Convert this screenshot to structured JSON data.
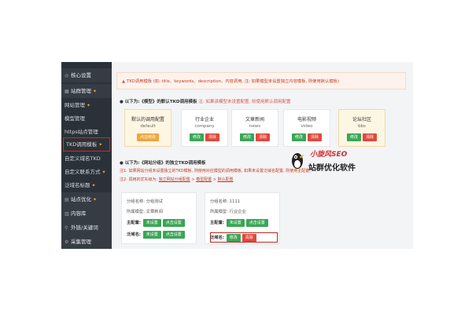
{
  "sidebar": {
    "items": [
      {
        "label": "核心设置",
        "type": "main"
      },
      {
        "label": "站群管理",
        "type": "main",
        "fire": true
      },
      {
        "label": "网站管理",
        "type": "sub",
        "fire": true
      },
      {
        "label": "模型管理",
        "type": "sub"
      },
      {
        "label": "https站点管理",
        "type": "sub"
      },
      {
        "label": "TKD调用模板",
        "type": "sub",
        "fire": true,
        "active": true
      },
      {
        "label": "自定义域名TKD",
        "type": "sub"
      },
      {
        "label": "自定义联系方式",
        "type": "sub",
        "fire": true
      },
      {
        "label": "泛域名标题",
        "type": "sub",
        "fire": true
      },
      {
        "label": "站点优化",
        "type": "main",
        "fire": true
      },
      {
        "label": "内容库",
        "type": "main"
      },
      {
        "label": "外链/关键词",
        "type": "main"
      },
      {
        "label": "采集管理",
        "type": "main"
      }
    ]
  },
  "notice": {
    "text": "TKD调用模板 (如: title、keywords、description、内容调用, 注: 如果模型未设置独立内容模板, 则使用默认模板)"
  },
  "model_section": {
    "title_prefix": "● 以下为:《模型》的默认TKD调用模板",
    "title_note": "注: 如果该模型未设置配置, 则使用默认调用配置",
    "cards": [
      {
        "name": "默认的调用配置",
        "code": "default",
        "selected": true,
        "buttons": [
          {
            "label": "点击修改",
            "color": "orange"
          }
        ]
      },
      {
        "name": "行业企业",
        "code": "company",
        "selected": false,
        "buttons": [
          {
            "label": "修改",
            "color": "green"
          },
          {
            "label": "清除",
            "color": "red"
          }
        ]
      },
      {
        "name": "文章新闻",
        "code": "news",
        "selected": false,
        "buttons": [
          {
            "label": "修改",
            "color": "green"
          },
          {
            "label": "清除",
            "color": "red"
          }
        ]
      },
      {
        "name": "电影视频",
        "code": "video",
        "selected": false,
        "buttons": [
          {
            "label": "修改",
            "color": "green"
          },
          {
            "label": "清除",
            "color": "red"
          }
        ]
      },
      {
        "name": "论坛社区",
        "code": "bbs",
        "selected": true,
        "buttons": [
          {
            "label": "修改",
            "color": "green"
          },
          {
            "label": "清除",
            "color": "red"
          }
        ]
      }
    ]
  },
  "group_section": {
    "title_prefix": "● 以下为:《网站分组》的独立TKD调用模板",
    "note1": "注1: 如果网站分组未设置独立的TKD模板, 则使用对应模型的调用模板, 如果未设置泛域名配置, 则使用主配置;",
    "note2_prefix": "注2: 调用的优先级为: ",
    "note2_links": [
      "独立网站分组配置",
      "模型配置",
      "默认配置"
    ],
    "panels": [
      {
        "group_name_label": "分组名称:",
        "group_name": "分组测试",
        "model_label": "所属模型:",
        "model": "文章新闻",
        "main_label": "主配置:",
        "main_buttons": [
          {
            "label": "未设置",
            "color": "green"
          },
          {
            "label": "点击设置",
            "color": "green"
          }
        ],
        "domain_label": "泛域名:",
        "domain_buttons": [
          {
            "label": "未设置",
            "color": "green"
          },
          {
            "label": "点击设置",
            "color": "green"
          }
        ],
        "highlight": false
      },
      {
        "group_name_label": "分组名称:",
        "group_name": "1111",
        "model_label": "所属模型:",
        "model": "行业企业",
        "main_label": "主配置:",
        "main_buttons": [
          {
            "label": "未设置",
            "color": "green"
          },
          {
            "label": "点击设置",
            "color": "green"
          }
        ],
        "domain_label": "泛域名:",
        "domain_buttons": [
          {
            "label": "修改",
            "color": "green"
          },
          {
            "label": "清除",
            "color": "red"
          }
        ],
        "highlight": true
      }
    ]
  },
  "watermark": {
    "line1": "小旋风SEO",
    "line2": "站群优化软件"
  },
  "colors": {
    "sidebar_bg": "#2b3138",
    "accent_red": "#e02020",
    "btn_green": "#3aa655",
    "btn_red": "#e0483d",
    "btn_orange": "#f0a53a"
  }
}
